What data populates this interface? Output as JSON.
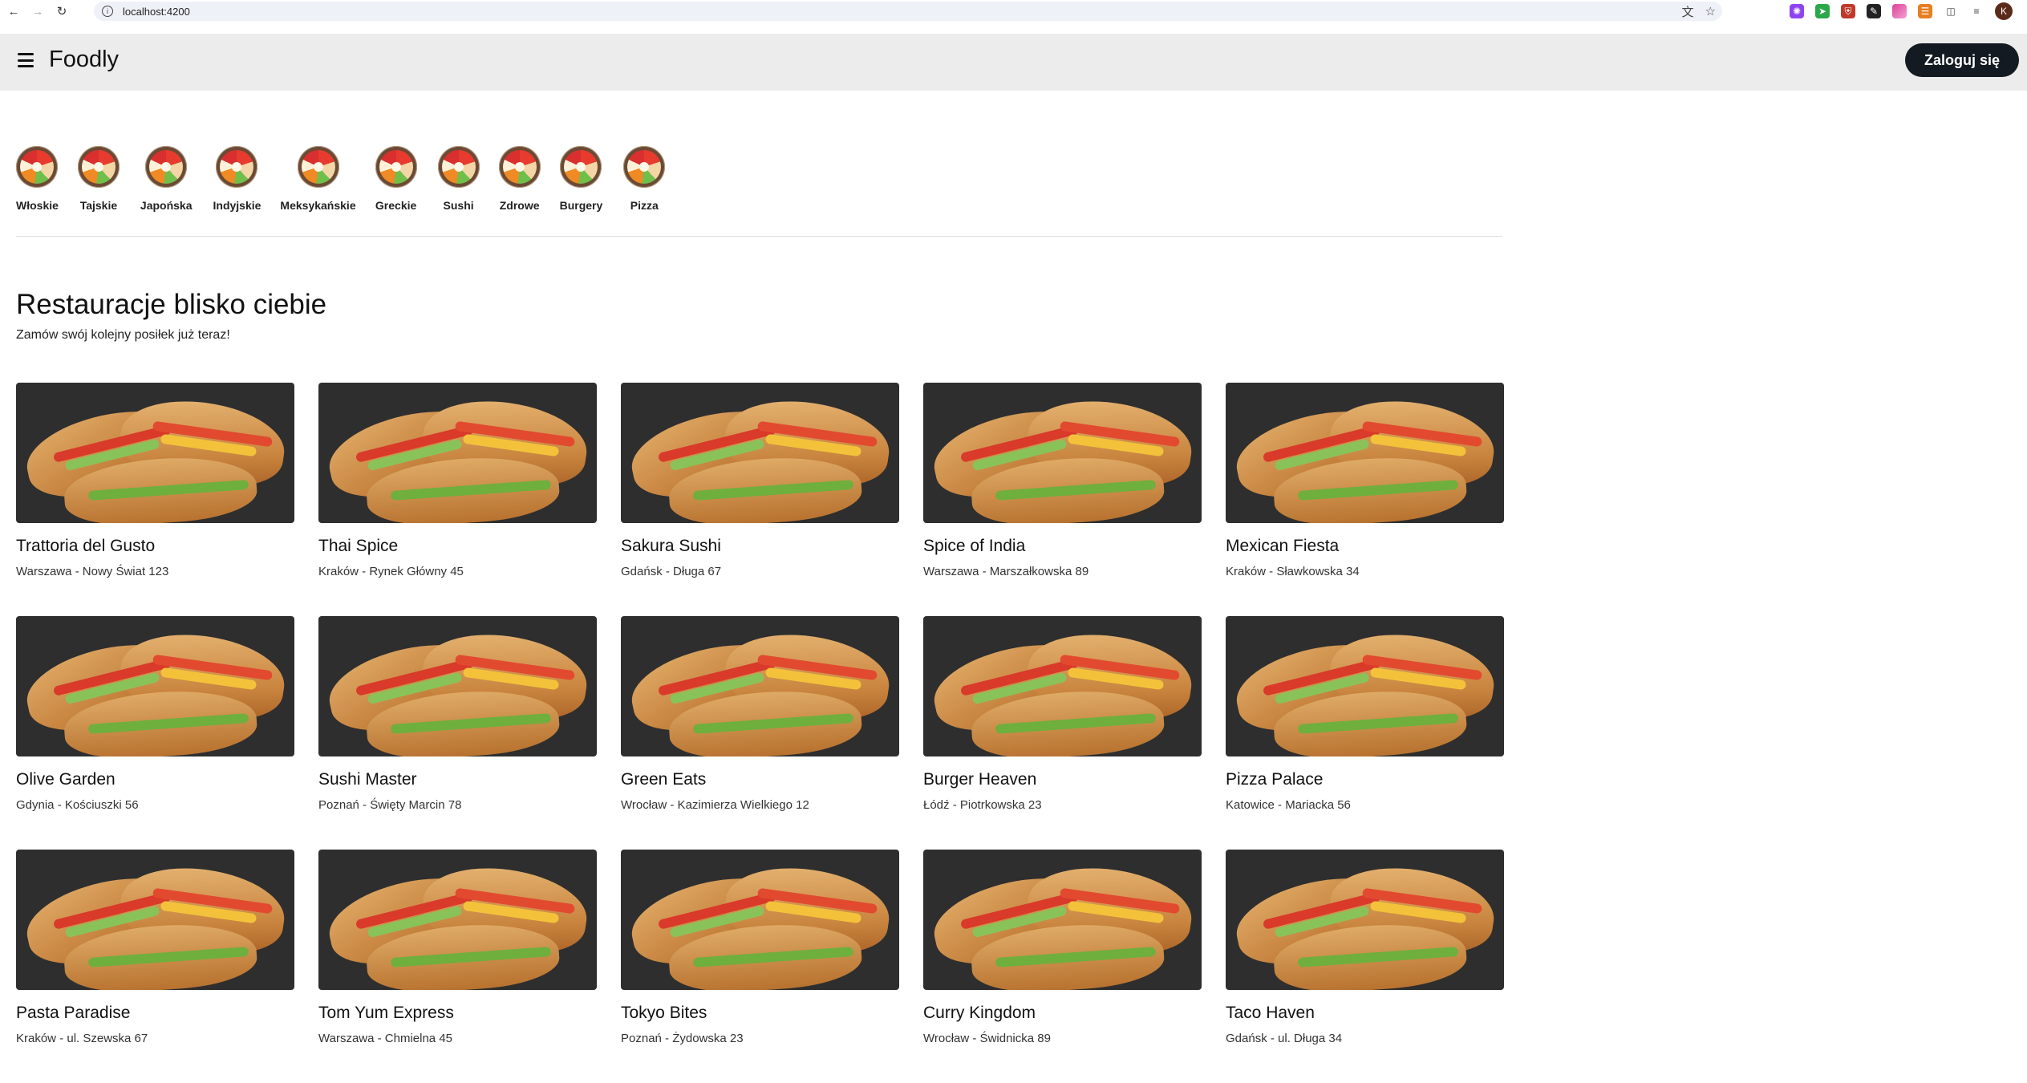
{
  "browser": {
    "url": "localhost:4200",
    "profile_initial": "K",
    "extensions": [
      {
        "icon": "translate-icon"
      },
      {
        "icon": "star-icon"
      },
      {
        "icon": "extension-purple-icon",
        "color": "#8e44ef"
      },
      {
        "icon": "extension-green-icon",
        "color": "#2aa84a"
      },
      {
        "icon": "extension-shield-icon",
        "color": "#c0392b"
      },
      {
        "icon": "extension-pen-icon",
        "color": "#222222"
      },
      {
        "icon": "extension-gradient-icon",
        "color": "#e0409a"
      },
      {
        "icon": "extension-burger-icon",
        "color": "#e67e22"
      },
      {
        "icon": "puzzle-icon"
      },
      {
        "icon": "menu-icon"
      }
    ]
  },
  "header": {
    "brand": "Foodly",
    "login_label": "Zaloguj się"
  },
  "categories": [
    "Włoskie",
    "Tajskie",
    "Japońska",
    "Indyjskie",
    "Meksykańskie",
    "Greckie",
    "Sushi",
    "Zdrowe",
    "Burgery",
    "Pizza"
  ],
  "section": {
    "title": "Restauracje blisko ciebie",
    "subtitle": "Zamów swój kolejny posiłek już teraz!"
  },
  "restaurants": [
    {
      "name": "Trattoria del Gusto",
      "address": "Warszawa - Nowy Świat 123"
    },
    {
      "name": "Thai Spice",
      "address": "Kraków - Rynek Główny 45"
    },
    {
      "name": "Sakura Sushi",
      "address": "Gdańsk - Długa 67"
    },
    {
      "name": "Spice of India",
      "address": "Warszawa - Marszałkowska 89"
    },
    {
      "name": "Mexican Fiesta",
      "address": "Kraków - Sławkowska 34"
    },
    {
      "name": "Olive Garden",
      "address": "Gdynia - Kościuszki 56"
    },
    {
      "name": "Sushi Master",
      "address": "Poznań - Święty Marcin 78"
    },
    {
      "name": "Green Eats",
      "address": "Wrocław - Kazimierza Wielkiego 12"
    },
    {
      "name": "Burger Heaven",
      "address": "Łódź - Piotrkowska 23"
    },
    {
      "name": "Pizza Palace",
      "address": "Katowice - Mariacka 56"
    },
    {
      "name": "Pasta Paradise",
      "address": "Kraków - ul. Szewska 67"
    },
    {
      "name": "Tom Yum Express",
      "address": "Warszawa - Chmielna 45"
    },
    {
      "name": "Tokyo Bites",
      "address": "Poznań - Żydowska 23"
    },
    {
      "name": "Curry Kingdom",
      "address": "Wrocław - Świdnicka 89"
    },
    {
      "name": "Taco Haven",
      "address": "Gdańsk - ul. Długa 34"
    }
  ]
}
